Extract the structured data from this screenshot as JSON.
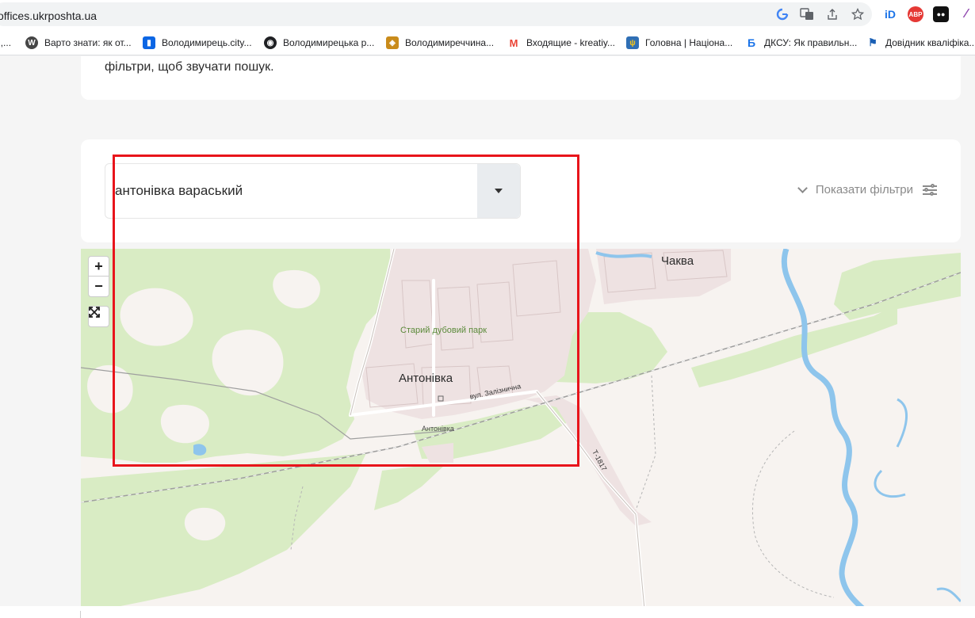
{
  "browser": {
    "url": "offices.ukrposhta.ua",
    "bookmarks": [
      {
        "label": "и,...",
        "icon": "generic-icon",
        "color": "#999999"
      },
      {
        "label": "Варто знати: як от...",
        "icon": "wordpress-icon",
        "color": "#464646"
      },
      {
        "label": "Володимирець.city...",
        "icon": "trello-icon",
        "color": "#0c66e4"
      },
      {
        "label": "Володимирецька р...",
        "icon": "globe-icon",
        "color": "#202124"
      },
      {
        "label": "Володимиреччина...",
        "icon": "layers-icon",
        "color": "#c98b1a"
      },
      {
        "label": "Входящие - kreatiy...",
        "icon": "gmail-icon",
        "color": "#ea4335"
      },
      {
        "label": "Головна | Націона...",
        "icon": "trident-icon",
        "color": "#2f6fb5"
      },
      {
        "label": "ДКСУ: Як правильн...",
        "icon": "b-icon",
        "color": "#1a73e8"
      },
      {
        "label": "Довідник кваліфіка...",
        "icon": "flag-icon",
        "color": "#1a5fb4"
      }
    ]
  },
  "intro": {
    "text": "фільтри, щоб звучати пошук."
  },
  "search": {
    "value": "антонівка вараський",
    "filters_label": "Показати фільтри"
  },
  "map": {
    "zoom_in": "+",
    "zoom_out": "−",
    "labels": {
      "village_main": "Антонівка",
      "village_small": "Антонівка",
      "village_north": "Чаква",
      "park": "Старий дубовий парк",
      "street": "вул. Залізнична",
      "road": "Т-1817"
    }
  }
}
